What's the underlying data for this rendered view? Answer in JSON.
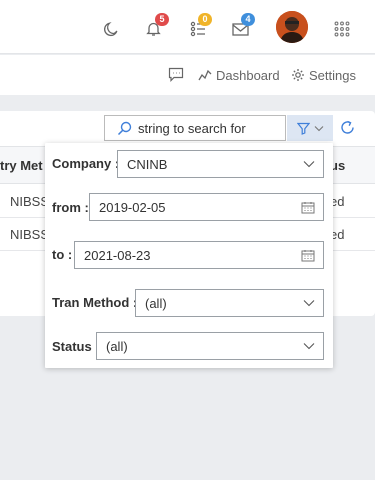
{
  "topbar": {
    "badges": {
      "notifications": "5",
      "tasks": "0",
      "messages": "4"
    },
    "badge_colors": {
      "notifications": "#e04b4b",
      "tasks": "#f0b429",
      "messages": "#3f8fdc"
    },
    "icons": [
      "moon-icon",
      "bell-icon",
      "tasks-icon",
      "mail-icon",
      "avatar",
      "apps-grid-icon"
    ]
  },
  "subbar": {
    "chat_icon": "chat-icon",
    "dashboard_label": "Dashboard",
    "settings_label": "Settings"
  },
  "toolbar": {
    "search_placeholder": "string to search for"
  },
  "table": {
    "headers": [
      "try Met",
      "us"
    ],
    "rows": [
      [
        "NIBSS",
        "ed"
      ],
      [
        "NIBSS",
        "ed"
      ]
    ]
  },
  "filter": {
    "company": {
      "label": "Company :",
      "value": "CNINB"
    },
    "from": {
      "label": "from :",
      "value": "2019-02-05"
    },
    "to": {
      "label": "to :",
      "value": "2021-08-23"
    },
    "tran_method": {
      "label": "Tran Method :",
      "value": "(all)"
    },
    "status": {
      "label": "Status :",
      "value": "(all)"
    }
  },
  "colors": {
    "accent": "#3f7fd9",
    "filter_button_bg": "#dde6f3"
  }
}
